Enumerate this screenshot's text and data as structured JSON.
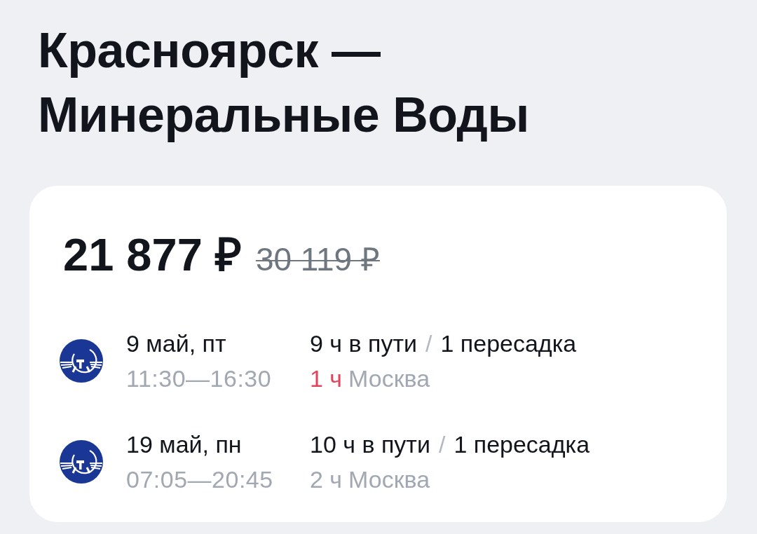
{
  "title": [
    "Красноярск —",
    "Минеральные Воды"
  ],
  "offer": {
    "price": "21 877 ₽",
    "old_price": "30 119 ₽",
    "segments": [
      {
        "date": "9 май, пт",
        "times": "11:30—16:30",
        "duration": "9 ч в пути",
        "separator": "/",
        "transfers": "1 пересадка",
        "layover_duration": "1 ч",
        "layover_city": "Москва",
        "short_layover": true
      },
      {
        "date": "19 май, пн",
        "times": "07:05—20:45",
        "duration": "10 ч в пути",
        "separator": "/",
        "transfers": "1 пересадка",
        "layover_duration": "2 ч",
        "layover_city": "Москва",
        "short_layover": false
      }
    ]
  }
}
